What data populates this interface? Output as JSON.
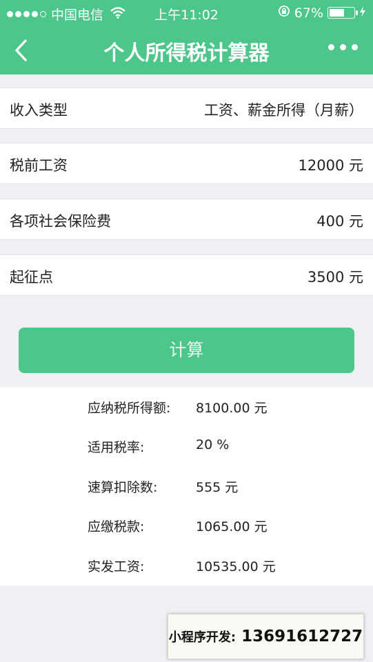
{
  "status": {
    "carrier": "中国电信",
    "time": "上午11:02",
    "battery": "67%",
    "battery_level": 0.67
  },
  "nav": {
    "title": "个人所得税计算器"
  },
  "form": {
    "income_type_label": "收入类型",
    "income_type_value": "工资、薪金所得（月薪）",
    "salary_label": "税前工资",
    "salary_value": "12000 元",
    "insurance_label": "各项社会保险费",
    "insurance_value": "400 元",
    "threshold_label": "起征点",
    "threshold_value": "3500 元"
  },
  "calc_button": "计算",
  "results": [
    {
      "label": "应纳税所得额:",
      "value": "8100.00 元"
    },
    {
      "label": "适用税率:",
      "value": "20 %"
    },
    {
      "label": "速算扣除数:",
      "value": "555 元"
    },
    {
      "label": "应缴税款:",
      "value": "1065.00 元"
    },
    {
      "label": "实发工资:",
      "value": "10535.00 元"
    }
  ],
  "promo": {
    "label": "小程序开发:",
    "phone": "13691612727"
  },
  "colors": {
    "accent": "#4cc68a",
    "background": "#efeff4"
  }
}
